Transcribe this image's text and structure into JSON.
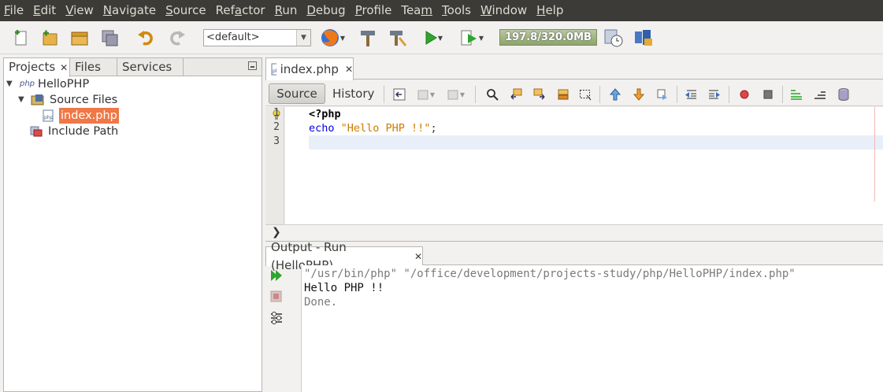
{
  "menu": [
    {
      "mnemonic": "F",
      "rest": "ile"
    },
    {
      "mnemonic": "E",
      "rest": "dit"
    },
    {
      "mnemonic": "V",
      "rest": "iew"
    },
    {
      "mnemonic": "N",
      "rest": "avigate"
    },
    {
      "mnemonic": "S",
      "rest": "ource"
    },
    {
      "pre": "Ref",
      "mnemonic": "a",
      "rest": "ctor"
    },
    {
      "mnemonic": "R",
      "rest": "un"
    },
    {
      "mnemonic": "D",
      "rest": "ebug"
    },
    {
      "mnemonic": "P",
      "rest": "rofile"
    },
    {
      "pre": "Tea",
      "mnemonic": "m",
      "rest": ""
    },
    {
      "mnemonic": "T",
      "rest": "ools"
    },
    {
      "mnemonic": "W",
      "rest": "indow"
    },
    {
      "mnemonic": "H",
      "rest": "elp"
    }
  ],
  "toolbar": {
    "config_value": "<default>",
    "memory": "197.8/320.0MB"
  },
  "left_tabs": {
    "projects": "Projects",
    "files": "Files",
    "services": "Services"
  },
  "tree": {
    "project": "HelloPHP",
    "source_files": "Source Files",
    "index_file": "index.php",
    "include_path": "Include Path",
    "php_badge": "php"
  },
  "editor": {
    "tab": "index.php",
    "source_btn": "Source",
    "history_btn": "History",
    "line_numbers": [
      "1",
      "2",
      "3"
    ],
    "line1": "<?php",
    "line2_kw": "echo",
    "line2_str": "\"Hello PHP !!\"",
    "line2_end": ";"
  },
  "output": {
    "tab": "Output - Run (HelloPHP)",
    "cmd": "\"/usr/bin/php\" \"/office/development/projects-study/php/HelloPHP/index.php\"",
    "result": "Hello PHP !!",
    "done": "Done."
  },
  "colors": {
    "menubar": "#3c3b37",
    "selection": "#f07746"
  }
}
